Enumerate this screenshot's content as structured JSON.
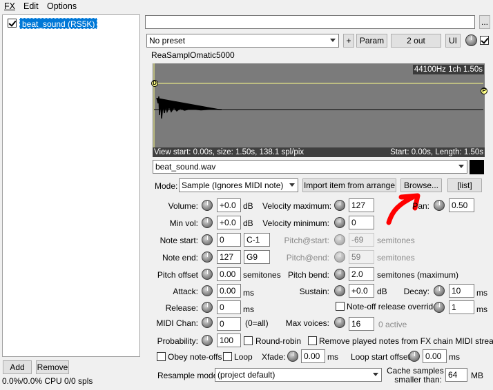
{
  "menu": {
    "fx": "FX",
    "edit": "Edit",
    "options": "Options"
  },
  "fx_list": {
    "items": [
      {
        "label": "beat_sound (RS5K)",
        "checked": true
      }
    ]
  },
  "left_footer": {
    "add": "Add",
    "remove": "Remove",
    "status": "0.0%/0.0% CPU 0/0 spls"
  },
  "header": {
    "name_value": "",
    "more": "...",
    "preset": "No preset",
    "plus": "+",
    "param": "Param",
    "out": "2 out",
    "ui": "UI",
    "bypass_checked": true
  },
  "plugin": {
    "title": "ReaSamplOmatic5000"
  },
  "waveform": {
    "info": "44100Hz 1ch 1.50s",
    "view_text": "View start: 0.00s, size: 1.50s, 138.1 spl/pix",
    "start_text": "Start: 0.00s, Length: 1.50s",
    "marker_left": "D",
    "marker_right": "P"
  },
  "file": {
    "selected": "beat_sound.wav"
  },
  "mode": {
    "label": "Mode:",
    "value": "Sample (Ignores MIDI note)",
    "import": "Import item from arrange",
    "browse": "Browse...",
    "list": "[list]"
  },
  "params": {
    "volume": {
      "label": "Volume:",
      "value": "+0.0",
      "unit": "dB"
    },
    "min_vol": {
      "label": "Min vol:",
      "value": "+0.0",
      "unit": "dB"
    },
    "note_start": {
      "label": "Note start:",
      "value": "0",
      "note": "C-1"
    },
    "note_end": {
      "label": "Note end:",
      "value": "127",
      "note": "G9"
    },
    "pitch_offset": {
      "label": "Pitch offset",
      "value": "0.00",
      "unit": "semitones"
    },
    "attack": {
      "label": "Attack:",
      "value": "0.00",
      "unit": "ms"
    },
    "release": {
      "label": "Release:",
      "value": "0",
      "unit": "ms"
    },
    "midi_chan": {
      "label": "MIDI Chan:",
      "value": "0",
      "unit": "(0=all)"
    },
    "probability": {
      "label": "Probability:",
      "value": "100"
    },
    "round_robin": "Round-robin",
    "vel_max": {
      "label": "Velocity maximum:",
      "value": "127"
    },
    "vel_min": {
      "label": "Velocity minimum:",
      "value": "0"
    },
    "pitch_start": {
      "label": "Pitch@start:",
      "value": "-69",
      "unit": "semitones"
    },
    "pitch_end": {
      "label": "Pitch@end:",
      "value": "59",
      "unit": "semitones"
    },
    "pitch_bend": {
      "label": "Pitch bend:",
      "value": "2.0",
      "unit": "semitones (maximum)"
    },
    "sustain": {
      "label": "Sustain:",
      "value": "+0.0",
      "unit": "dB"
    },
    "note_off": "Note-off release override:",
    "max_voices": {
      "label": "Max voices:",
      "value": "16",
      "status": "0 active"
    },
    "pan": {
      "label": "Pan:",
      "value": "0.50"
    },
    "decay": {
      "label": "Decay:",
      "value": "10",
      "unit": "ms"
    },
    "noteoff_val": {
      "value": "1",
      "unit": "ms"
    },
    "remove_played": "Remove played notes from FX chain MIDI stream",
    "obey": "Obey note-offs",
    "loop": "Loop",
    "xfade": {
      "label": "Xfade:",
      "value": "0.00",
      "unit": "ms"
    },
    "loop_start": {
      "label": "Loop start offset:",
      "value": "0.00",
      "unit": "ms"
    },
    "resample": {
      "label": "Resample mode:",
      "value": "(project default)"
    },
    "cache": {
      "label1": "Cache samples",
      "label2": "smaller than:",
      "value": "64",
      "unit": "MB"
    }
  },
  "colors": {
    "accent": "#0078d7",
    "annotation": "#ff0000",
    "wave_bg": "#7b7b7b",
    "env_line": "#ffff88"
  }
}
